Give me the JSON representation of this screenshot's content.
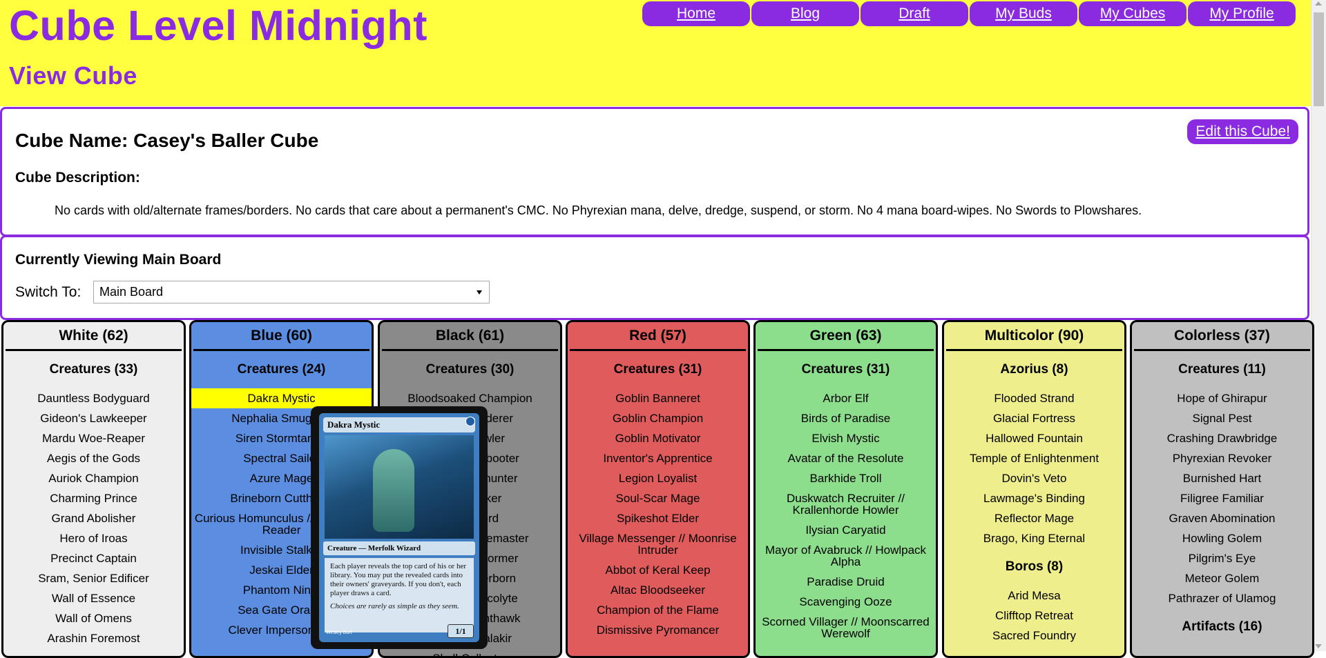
{
  "header": {
    "site_title": "Cube Level Midnight",
    "page_subtitle": "View Cube"
  },
  "nav": [
    {
      "label": "Home"
    },
    {
      "label": "Blog"
    },
    {
      "label": "Draft"
    },
    {
      "label": "My Buds"
    },
    {
      "label": "My Cubes"
    },
    {
      "label": "My Profile"
    }
  ],
  "cube": {
    "name": "Cube Name: Casey's Baller Cube",
    "edit_label": "Edit this Cube!",
    "description_label": "Cube Description:",
    "description": "No cards with old/alternate frames/borders. No cards that care about a permanent's CMC. No Phyrexian mana, delve, dredge, suspend, or storm. No 4 mana board-wipes. No Swords to Plowshares."
  },
  "board": {
    "viewing_label": "Currently Viewing Main Board",
    "switch_label": "Switch To:",
    "selected": "Main Board"
  },
  "columns": [
    {
      "name": "White (62)",
      "color": "#eeeeee",
      "sections": [
        {
          "title": "Creatures (33)",
          "cards": [
            "Dauntless Bodyguard",
            "Gideon's Lawkeeper",
            "Mardu Woe-Reaper",
            "Aegis of the Gods",
            "Auriok Champion",
            "Charming Prince",
            "Grand Abolisher",
            "Hero of Iroas",
            "Precinct Captain",
            "Sram, Senior Edificer",
            "Wall of Essence",
            "Wall of Omens",
            "Arashin Foremost"
          ]
        }
      ]
    },
    {
      "name": "Blue (60)",
      "color": "#5b8ee0",
      "sections": [
        {
          "title": "Creatures (24)",
          "cards": [
            "Dakra Mystic",
            "Nephalia Smuggler",
            "Siren Stormtamer",
            "Spectral Sailor",
            "Azure Mage",
            "Brineborn Cutthroat",
            "Curious Homunculus // Voracious Reader",
            "Invisible Stalker",
            "Jeskai Elder",
            "Phantom Ninja",
            "Sea Gate Oracle",
            "Clever Impersonator"
          ]
        }
      ]
    },
    {
      "name": "Black (61)",
      "color": "#8a8a8a",
      "sections": [
        {
          "title": "Creatures (30)",
          "cards": [
            "Bloodsoaked Champion",
            "Dread Wanderer",
            "Gravecrawler",
            "Kitesail Freebooter",
            "Mardu Skullhunter",
            "Tombstalker",
            "Demonlord",
            "Lazotep Plaguemaster",
            "Undercity Informer",
            "Gifted Aetherborn",
            "Yawgmoth Acolyte",
            "Vampire Nighthawk",
            "Pawn of Malakir",
            "Skull Collecter"
          ]
        }
      ]
    },
    {
      "name": "Red (57)",
      "color": "#e05c5c",
      "sections": [
        {
          "title": "Creatures (31)",
          "cards": [
            "Goblin Banneret",
            "Goblin Champion",
            "Goblin Motivator",
            "Inventor's Apprentice",
            "Legion Loyalist",
            "Soul-Scar Mage",
            "Spikeshot Elder",
            "Village Messenger // Moonrise Intruder",
            "Abbot of Keral Keep",
            "Altac Bloodseeker",
            "Champion of the Flame",
            "Dismissive Pyromancer"
          ]
        }
      ]
    },
    {
      "name": "Green (63)",
      "color": "#8cde8c",
      "sections": [
        {
          "title": "Creatures (31)",
          "cards": [
            "Arbor Elf",
            "Birds of Paradise",
            "Elvish Mystic",
            "Avatar of the Resolute",
            "Barkhide Troll",
            "Duskwatch Recruiter // Krallenhorde Howler",
            "Ilysian Caryatid",
            "Mayor of Avabruck // Howlpack Alpha",
            "Paradise Druid",
            "Scavenging Ooze",
            "Scorned Villager // Moonscarred Werewolf"
          ]
        }
      ]
    },
    {
      "name": "Multicolor (90)",
      "color": "#eeee8c",
      "sections": [
        {
          "title": "Azorius (8)",
          "cards": [
            "Flooded Strand",
            "Glacial Fortress",
            "Hallowed Fountain",
            "Temple of Enlightenment",
            "Dovin's Veto",
            "Lawmage's Binding",
            "Reflector Mage",
            "Brago, King Eternal"
          ]
        },
        {
          "title": "Boros (8)",
          "cards": [
            "Arid Mesa",
            "Clifftop Retreat",
            "Sacred Foundry"
          ]
        }
      ]
    },
    {
      "name": "Colorless (37)",
      "color": "#c0c0c0",
      "sections": [
        {
          "title": "Creatures (11)",
          "cards": [
            "Hope of Ghirapur",
            "Signal Pest",
            "Crashing Drawbridge",
            "Phyrexian Revoker",
            "Burnished Hart",
            "Filigree Familiar",
            "Graven Abomination",
            "Howling Golem",
            "Pilgrim's Eye",
            "Meteor Golem",
            "Pathrazer of Ulamog"
          ]
        },
        {
          "title": "Artifacts (16)",
          "cards": []
        }
      ]
    }
  ],
  "preview": {
    "name": "Dakra Mystic",
    "type": "Creature — Merfolk Wizard",
    "rules": "Each player reveals the top card of his or her library. You may put the revealed cards into their owners' graveyards. If you don't, each player draws a card.",
    "flavor": "Choices are rarely as simple as they seem.",
    "pt": "1/1",
    "artist": "Wesley Burt"
  }
}
